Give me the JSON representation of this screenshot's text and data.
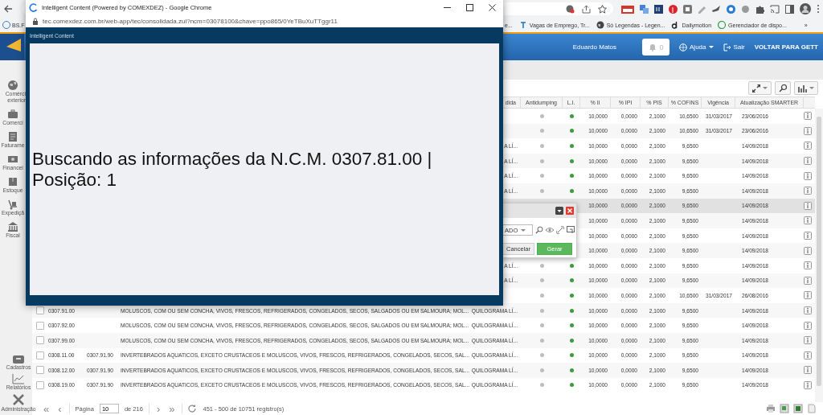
{
  "browser": {
    "bookmarks": [
      {
        "label": "BS.F"
      },
      {
        "label": "e..."
      },
      {
        "label": "Vagas de Emprego, Tr..."
      },
      {
        "label": "Só Legendas - Legen..."
      },
      {
        "label": "Dailymotion"
      },
      {
        "label": "Gerenciador de dispo..."
      }
    ],
    "more": "»"
  },
  "header": {
    "user": "Eduardo Matos",
    "notifications": "0",
    "help": "Ajuda",
    "logout": "Sair",
    "back_link": "VOLTAR PARA GETT"
  },
  "sidebar": {
    "top_items": [
      {
        "label": "Comérci exterior"
      },
      {
        "label": "Comerci"
      },
      {
        "label": "Faturame"
      },
      {
        "label": "Financei"
      },
      {
        "label": "Estoque"
      },
      {
        "label": "Expediçã"
      },
      {
        "label": "Fiscal"
      }
    ],
    "bottom_items": [
      {
        "label": "Cadastros"
      },
      {
        "label": "Relatórios"
      },
      {
        "label": "Administração"
      }
    ]
  },
  "table": {
    "columns": [
      "dida",
      "Antidumping",
      "L.I.",
      "% II",
      "% IPI",
      "% PIS",
      "% COFINS",
      "Vigência",
      "Atualização SMARTER"
    ],
    "rows": [
      {
        "antidumping": false,
        "li": true,
        "ii": "10,0000",
        "ipi": "0,0000",
        "pis": "2,1000",
        "cofins": "10,6500",
        "vigencia": "31/03/2017",
        "atualizacao": "23/06/2016",
        "selected": false
      },
      {
        "antidumping": false,
        "li": true,
        "ii": "10,0000",
        "ipi": "0,0000",
        "pis": "2,1000",
        "cofins": "10,6500",
        "vigencia": "31/03/2017",
        "atualizacao": "23/06/2016",
        "selected": false
      },
      {
        "unit": "A LÍ...",
        "antidumping": false,
        "li": true,
        "ii": "10,0000",
        "ipi": "0,0000",
        "pis": "2,1000",
        "cofins": "9,6500",
        "atualizacao": "14/09/2018",
        "selected": false
      },
      {
        "unit": "A LÍ...",
        "antidumping": false,
        "li": true,
        "ii": "10,0000",
        "ipi": "0,0000",
        "pis": "2,1000",
        "cofins": "9,6500",
        "atualizacao": "14/09/2018",
        "selected": false
      },
      {
        "unit": "A LÍ...",
        "antidumping": false,
        "li": true,
        "ii": "10,0000",
        "ipi": "0,0000",
        "pis": "2,1000",
        "cofins": "9,6500",
        "atualizacao": "14/09/2018",
        "selected": false
      },
      {
        "unit": "A LÍ...",
        "antidumping": false,
        "li": true,
        "ii": "10,0000",
        "ipi": "0,0000",
        "pis": "2,1000",
        "cofins": "9,6500",
        "atualizacao": "14/09/2018",
        "selected": false
      },
      {
        "ii": "10,0000",
        "ipi": "0,0000",
        "pis": "2,1000",
        "cofins": "9,6500",
        "atualizacao": "14/09/2018",
        "selected": true
      },
      {
        "ii": "10,0000",
        "ipi": "0,0000",
        "pis": "2,1000",
        "cofins": "9,6500",
        "atualizacao": "14/09/2018",
        "selected": false
      },
      {
        "ii": "10,0000",
        "ipi": "0,0000",
        "pis": "2,1000",
        "cofins": "9,6500",
        "atualizacao": "14/09/2018",
        "selected": false
      },
      {
        "ii": "10,0000",
        "ipi": "0,0000",
        "pis": "2,1000",
        "cofins": "9,6500",
        "atualizacao": "14/09/2018",
        "selected": false
      },
      {
        "unit": "A LÍ...",
        "antidumping": false,
        "li": true,
        "ii": "10,0000",
        "ipi": "0,0000",
        "pis": "2,1000",
        "cofins": "9,6500",
        "atualizacao": "14/09/2018",
        "selected": false
      },
      {
        "unit": "A LÍ...",
        "antidumping": false,
        "li": true,
        "ii": "10,0000",
        "ipi": "0,0000",
        "pis": "2,1000",
        "cofins": "9,6500",
        "atualizacao": "14/09/2018",
        "selected": false
      },
      {
        "antidumping": false,
        "li": true,
        "ii": "10,0000",
        "ipi": "0,0000",
        "pis": "2,1000",
        "cofins": "10,6500",
        "vigencia": "31/03/2017",
        "atualizacao": "26/08/2016",
        "selected": false
      },
      {
        "checked": false,
        "ncm": "0307.91.00",
        "description": "MOLUSCOS, COM OU SEM CONCHA, VIVOS, FRESCOS, REFRIGERADOS, CONGELADOS, SECOS, SALGADOS OU EM SALMOURA; MOL...",
        "unit": "QUILOGRAMA LÍ...",
        "antidumping": false,
        "li": true,
        "ii": "10,0000",
        "ipi": "0,0000",
        "pis": "2,1000",
        "cofins": "9,6500",
        "atualizacao": "14/09/2018",
        "selected": false
      },
      {
        "checked": false,
        "ncm": "0307.92.00",
        "description": "MOLUSCOS, COM OU SEM CONCHA, VIVOS, FRESCOS, REFRIGERADOS, CONGELADOS, SECOS, SALGADOS OU EM SALMOURA; MOL...",
        "unit": "QUILOGRAMA LÍ...",
        "antidumping": false,
        "li": true,
        "ii": "10,0000",
        "ipi": "0,0000",
        "pis": "2,1000",
        "cofins": "9,6500",
        "atualizacao": "14/09/2018",
        "selected": false
      },
      {
        "checked": false,
        "ncm": "0307.99.00",
        "description": "MOLUSCOS, COM OU SEM CONCHA, VIVOS, FRESCOS, REFRIGERADOS, CONGELADOS, SECOS, SALGADOS OU EM SALMOURA; MOL...",
        "unit": "QUILOGRAMA LÍ...",
        "antidumping": false,
        "li": true,
        "ii": "10,0000",
        "ipi": "0,0000",
        "pis": "2,1000",
        "cofins": "9,6500",
        "atualizacao": "14/09/2018",
        "selected": false
      },
      {
        "checked": false,
        "ncm": "0308.11.00",
        "ncm_ref": "0307.91.90",
        "description": "INVERTEBRADOS AQUATICOS, EXCETO CRUSTACEOS E MOLUSCOS, VIVOS, FRESCOS, REFRIGERADOS, CONGELADOS, SECOS, SAL...",
        "unit": "QUILOGRAMA LÍ...",
        "antidumping": false,
        "li": true,
        "ii": "10,0000",
        "ipi": "0,0000",
        "pis": "2,1000",
        "cofins": "9,6500",
        "atualizacao": "14/09/2018",
        "selected": false
      },
      {
        "checked": false,
        "ncm": "0308.12.00",
        "ncm_ref": "0307.91.90",
        "description": "INVERTEBRADOS AQUATICOS, EXCETO CRUSTACEOS E MOLUSCOS, VIVOS, FRESCOS, REFRIGERADOS, CONGELADOS, SECOS, SAL...",
        "unit": "QUILOGRAMA LÍ...",
        "antidumping": false,
        "li": true,
        "ii": "10,0000",
        "ipi": "0,0000",
        "pis": "2,1000",
        "cofins": "9,6500",
        "atualizacao": "14/09/2018",
        "selected": false
      },
      {
        "checked": false,
        "ncm": "0308.19.00",
        "ncm_ref": "0307.91.90",
        "description": "INVERTEBRADOS AQUATICOS, EXCETO CRUSTACEOS E MOLUSCOS, VIVOS, FRESCOS, REFRIGERADOS, CONGELADOS, SECOS, SAL...",
        "unit": "QUILOGRAMA LÍ...",
        "antidumping": false,
        "li": true,
        "ii": "10,0000",
        "ipi": "0,0000",
        "pis": "2,1000",
        "cofins": "9,6500",
        "atualizacao": "14/09/2018",
        "selected": false
      }
    ]
  },
  "pager": {
    "first": "«",
    "prev": "‹",
    "page_label": "Página",
    "page": "10",
    "of": "de 216",
    "next": "›",
    "last": "»",
    "summary": "451 - 500 de 10751 registro(s)"
  },
  "dialog": {
    "select_value": "ADO",
    "cancel": "Cancelar",
    "generate": "Gerar"
  },
  "popup": {
    "title": "Intelligent Content (Powered by COMEXDEZ) - Google Chrome",
    "url": "tec.comexdez.com.br/web-app/tec/consolidada.zul?ncm=03078100&chave=ppo865/0YeTBuXuTTggr11",
    "frame_title": "Intelligent Content",
    "message": "Buscando as informações da N.C.M. 0307.81.00 | Posição: 1"
  }
}
